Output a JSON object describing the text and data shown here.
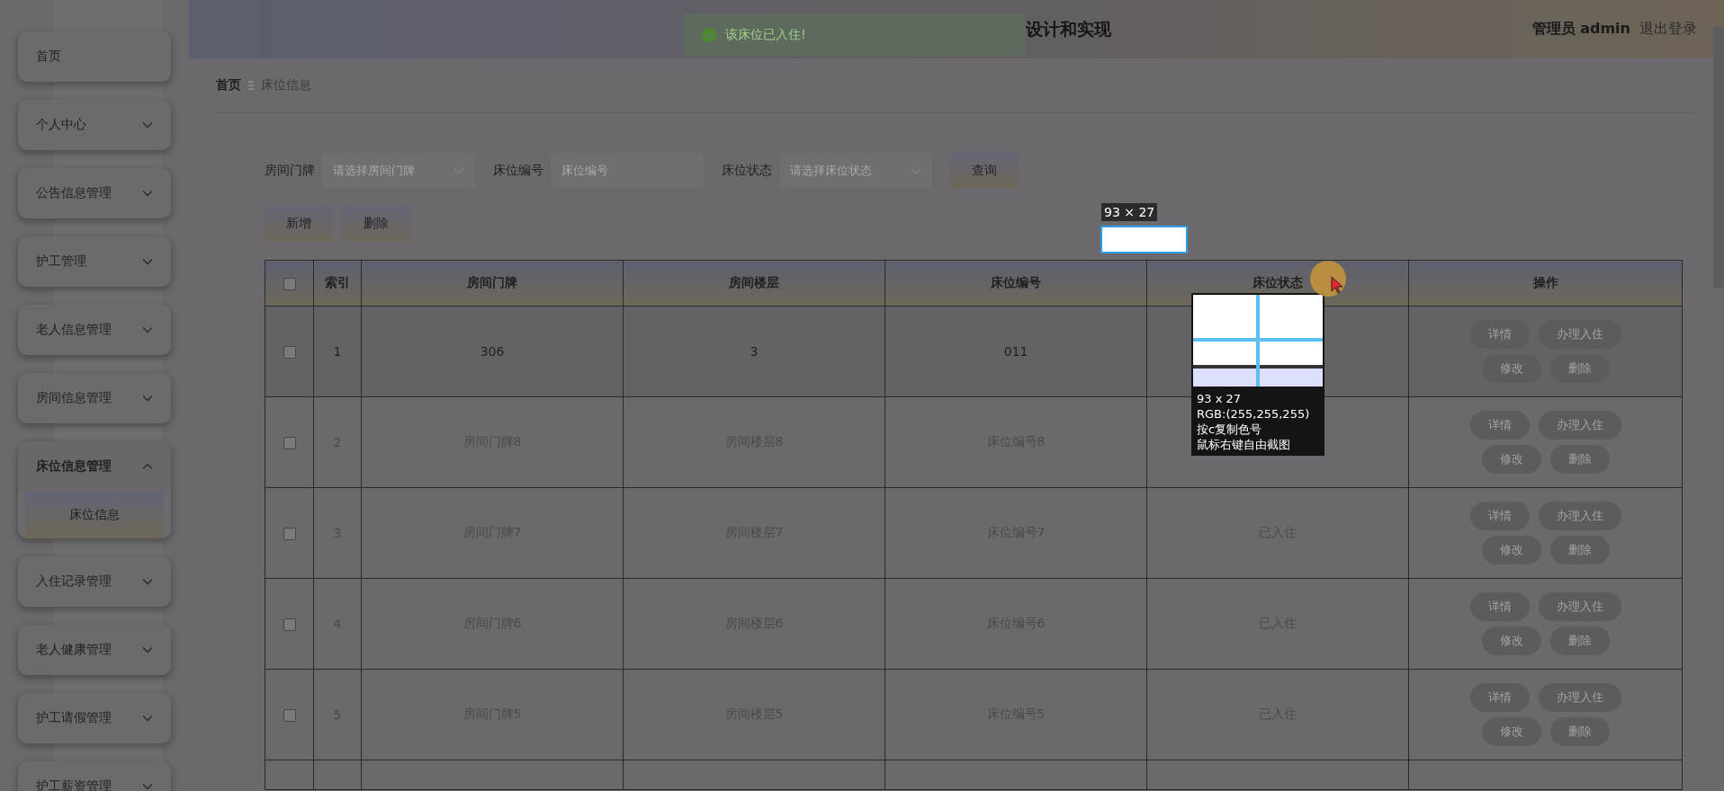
{
  "header": {
    "title": "设计和实现",
    "user_role": "管理员",
    "user_name": "admin",
    "logout": "退出登录"
  },
  "toast": {
    "message": "该床位已入住!"
  },
  "sidebar": {
    "items": [
      {
        "label": "首页",
        "expandable": false,
        "expanded": false
      },
      {
        "label": "个人中心",
        "expandable": true,
        "expanded": false
      },
      {
        "label": "公告信息管理",
        "expandable": true,
        "expanded": false
      },
      {
        "label": "护工管理",
        "expandable": true,
        "expanded": false
      },
      {
        "label": "老人信息管理",
        "expandable": true,
        "expanded": false
      },
      {
        "label": "房间信息管理",
        "expandable": true,
        "expanded": false
      },
      {
        "label": "床位信息管理",
        "expandable": true,
        "expanded": true,
        "children": [
          {
            "label": "床位信息",
            "selected": true
          }
        ]
      },
      {
        "label": "入住记录管理",
        "expandable": true,
        "expanded": false
      },
      {
        "label": "老人健康管理",
        "expandable": true,
        "expanded": false
      },
      {
        "label": "护工请假管理",
        "expandable": true,
        "expanded": false
      },
      {
        "label": "护工薪资管理",
        "expandable": true,
        "expanded": false
      }
    ]
  },
  "breadcrumb": [
    "首页",
    "床位信息"
  ],
  "search": {
    "fields": [
      {
        "label": "房间门牌",
        "kind": "select",
        "placeholder": "请选择房间门牌"
      },
      {
        "label": "床位编号",
        "kind": "input",
        "placeholder": "床位编号"
      },
      {
        "label": "床位状态",
        "kind": "select",
        "placeholder": "请选择床位状态"
      }
    ],
    "button": "查询"
  },
  "actions": [
    "新增",
    "删除"
  ],
  "table": {
    "select_all": {
      "checked": false
    },
    "columns": [
      "索引",
      "房间门牌",
      "房间楼层",
      "床位编号",
      "床位状态",
      "操作"
    ],
    "rows": [
      {
        "checked": false,
        "highlighted": true,
        "index": "1",
        "room": "306",
        "floor": "3",
        "bed": "011",
        "actions": [
          "详情",
          "办理入住",
          "修改",
          "删除"
        ]
      },
      {
        "checked": false,
        "highlighted": false,
        "index": "2",
        "room": "房间门牌8",
        "floor": "房间楼层8",
        "bed": "床位编号8",
        "actions": [
          "详情",
          "办理入住",
          "修改",
          "删除"
        ]
      },
      {
        "checked": false,
        "highlighted": false,
        "index": "3",
        "room": "房间门牌7",
        "floor": "房间楼层7",
        "bed": "床位编号7",
        "status": "已入住",
        "actions": [
          "详情",
          "办理入住",
          "修改",
          "删除"
        ]
      },
      {
        "checked": false,
        "highlighted": false,
        "index": "4",
        "room": "房间门牌6",
        "floor": "房间楼层6",
        "bed": "床位编号6",
        "status": "已入住",
        "actions": [
          "详情",
          "办理入住",
          "修改",
          "删除"
        ]
      },
      {
        "checked": false,
        "highlighted": false,
        "index": "5",
        "room": "房间门牌5",
        "floor": "房间楼层5",
        "bed": "床位编号5",
        "status": "已入住",
        "actions": [
          "详情",
          "办理入住",
          "修改",
          "删除"
        ]
      }
    ]
  },
  "snip": {
    "size_label": "93 × 27",
    "magnifier": [
      "93 x 27",
      "RGB:(255,255,255)",
      "按c复制色号",
      "鼠标右键自由截图"
    ]
  }
}
